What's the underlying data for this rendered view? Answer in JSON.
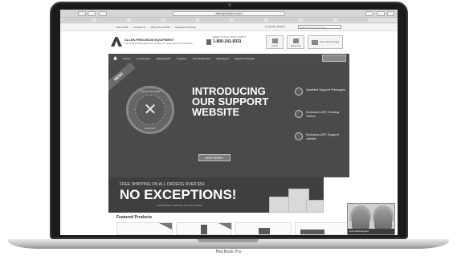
{
  "device": {
    "brand_label": "MacBook Pro"
  },
  "browser": {
    "url": "allenprecision.com"
  },
  "utility": {
    "links": [
      "About APE",
      "Contact Us",
      "Why shop at APE",
      "Request A Training"
    ],
    "language_label": "Language: English",
    "search_placeholder": "Search entire store here"
  },
  "header": {
    "logo_name": "ALLEN PRECISION EQUIPMENT",
    "logo_tagline": "The Online Marketplace for Surveyors, Engineers & Contractors",
    "call_label": "NEED TO TALK WITH A PRO?",
    "phone": "1-800-241-6031",
    "login_label": "Log In",
    "shoplist_label": "Shop List",
    "cart_label": "Your cart is empty"
  },
  "nav": {
    "items": [
      "Survey",
      "Construction",
      "Mapping/GIS",
      "Supplies",
      "Used Equipment",
      "Blackboard",
      "Repairs & Rentals"
    ]
  },
  "hero": {
    "ribbon": "NEW!",
    "badge_top": "APE ADVANTAGE",
    "badge_bottom": "SUPPORT",
    "title": "INTRODUCING OUR SUPPORT WEBSITE",
    "cta_label": "VISIT NOW",
    "features": [
      {
        "icon": "gear-check-icon",
        "text": "Updated Support Packages"
      },
      {
        "icon": "video-icon",
        "text": "Exclusive APE Training Videos"
      },
      {
        "icon": "document-icon",
        "text": "Exclusive APE Support Articles"
      }
    ]
  },
  "promo": {
    "small": "FREE SHIPPING ON ALL ORDERS OVER $50",
    "big": "NO EXCEPTIONS!",
    "fine": "*EXPEDITED SHIPPING NOT INCLUDED"
  },
  "featured": {
    "title": "Featured Products"
  },
  "chat": {
    "label": "Live Chat Support"
  }
}
